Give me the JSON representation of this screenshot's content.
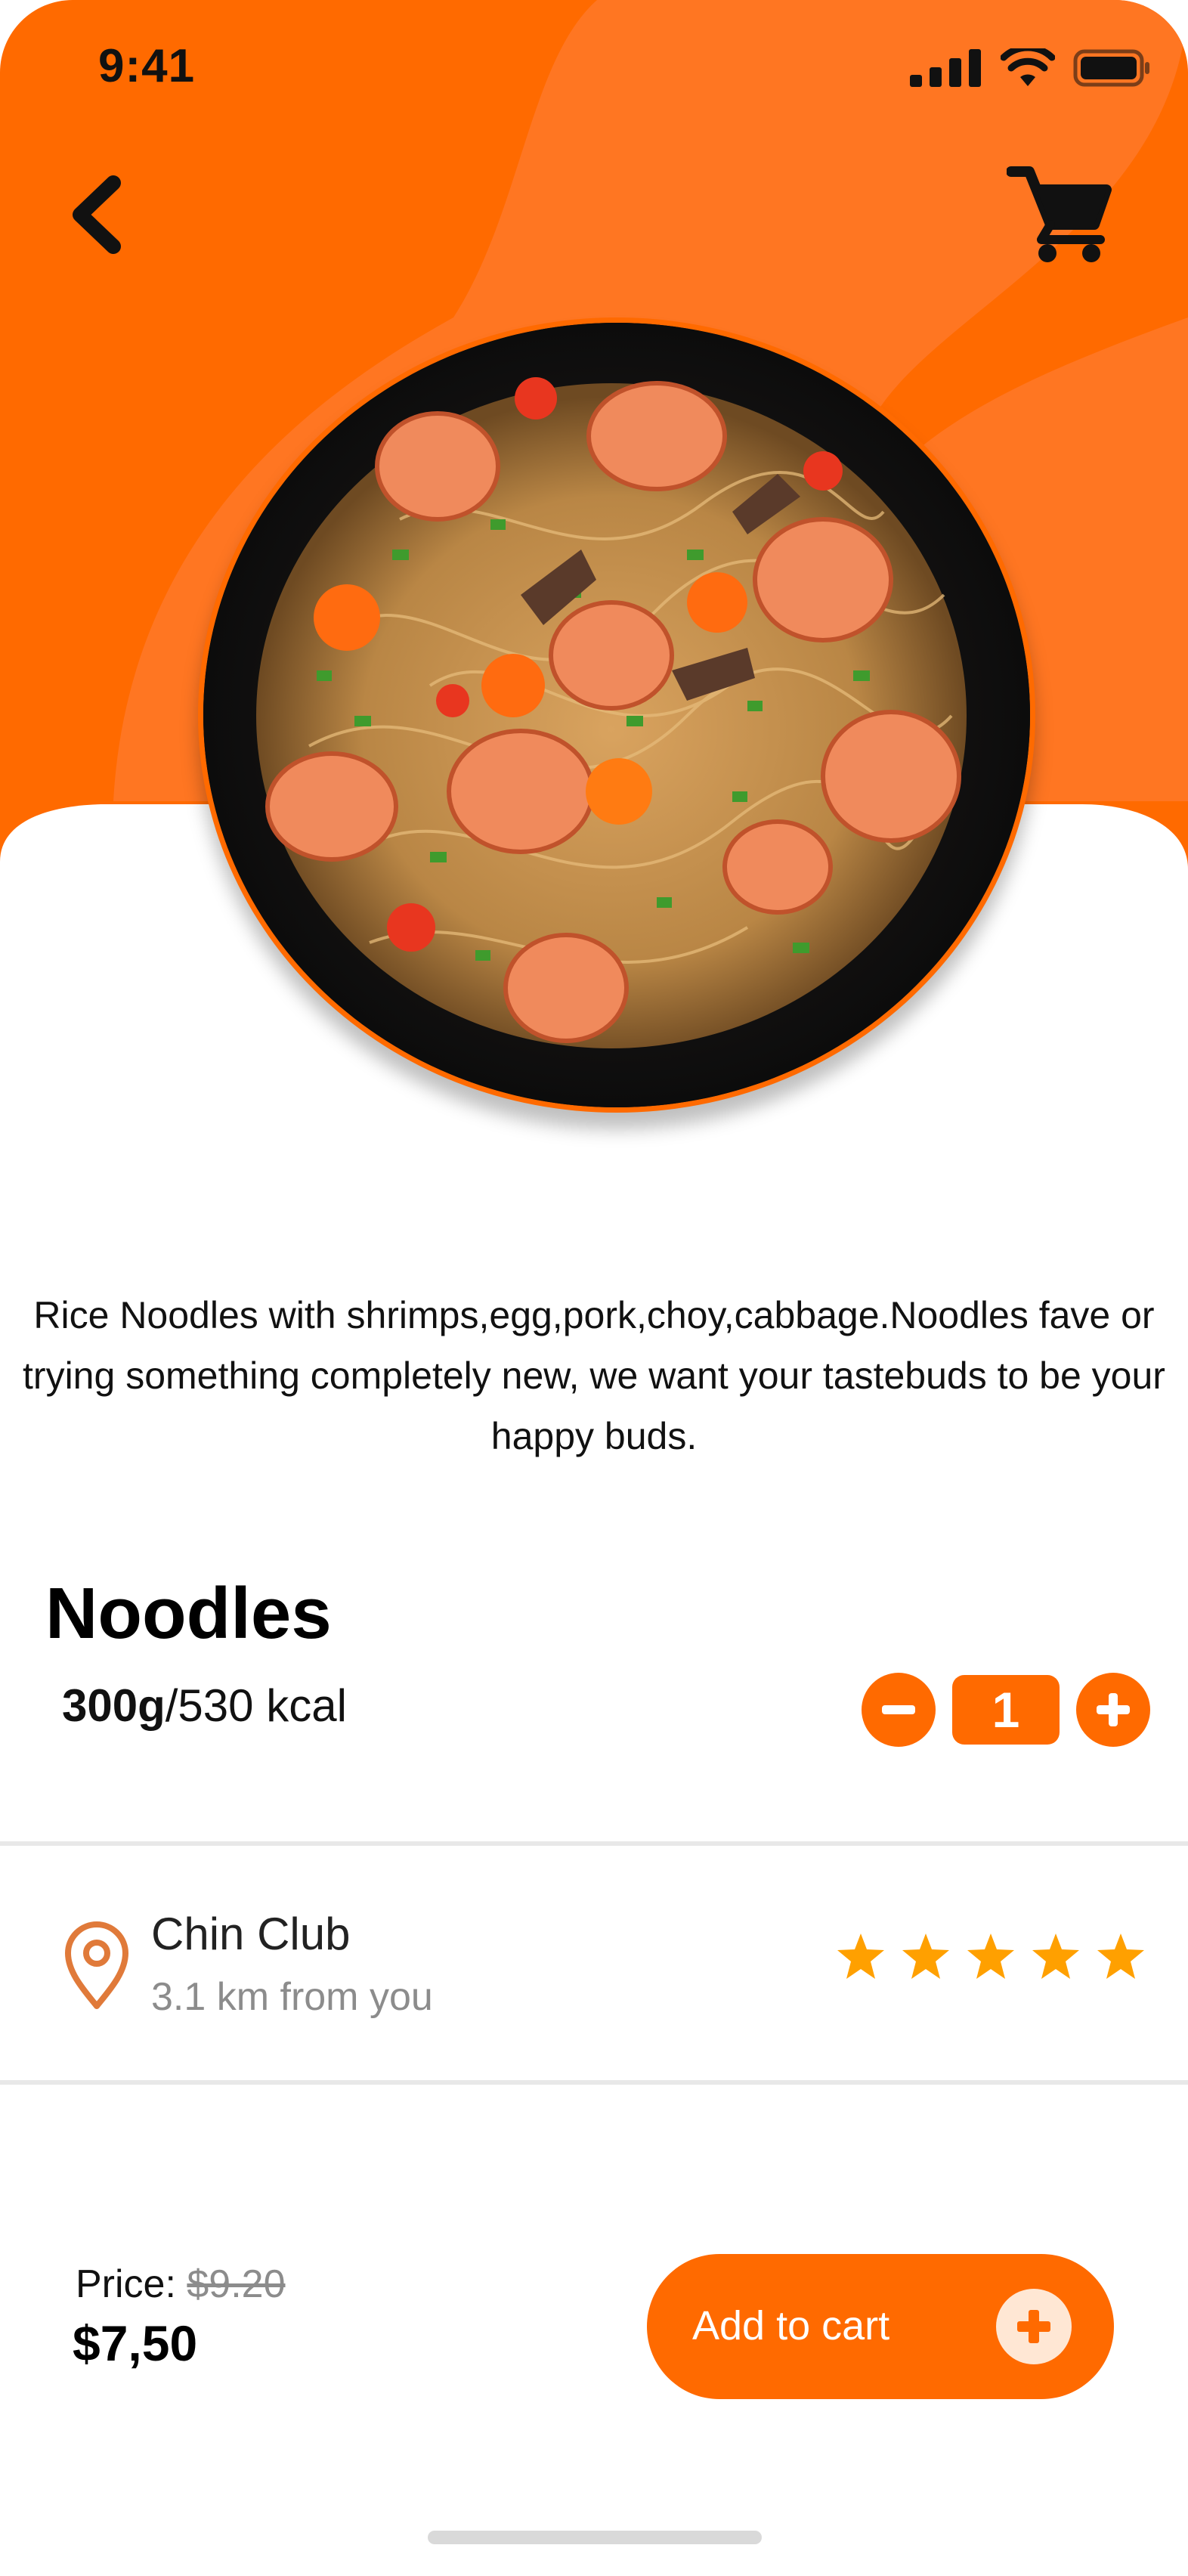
{
  "status_bar": {
    "time": "9:41"
  },
  "navigation": {
    "back_icon": "chevron-left-icon",
    "cart_icon": "shopping-cart-icon"
  },
  "product": {
    "description": "Rice Noodles with shrimps,egg,pork,choy,cabbage.Noodles fave or trying something completely new, we want your tastebuds to be your happy buds.",
    "name": "Noodles",
    "weight": "300g",
    "calories": "/530 kcal",
    "quantity": "1"
  },
  "store": {
    "name": "Chin Club",
    "distance": "3.1 km from you",
    "rating": 5,
    "icon": "location-pin-icon"
  },
  "pricing": {
    "label": "Price: ",
    "old_price": "$9.20",
    "current_price": "$7,50"
  },
  "actions": {
    "add_to_cart_label": "Add to cart"
  },
  "colors": {
    "accent": "#ff6a00",
    "star": "#ffa000",
    "pin": "#e07a3a"
  }
}
